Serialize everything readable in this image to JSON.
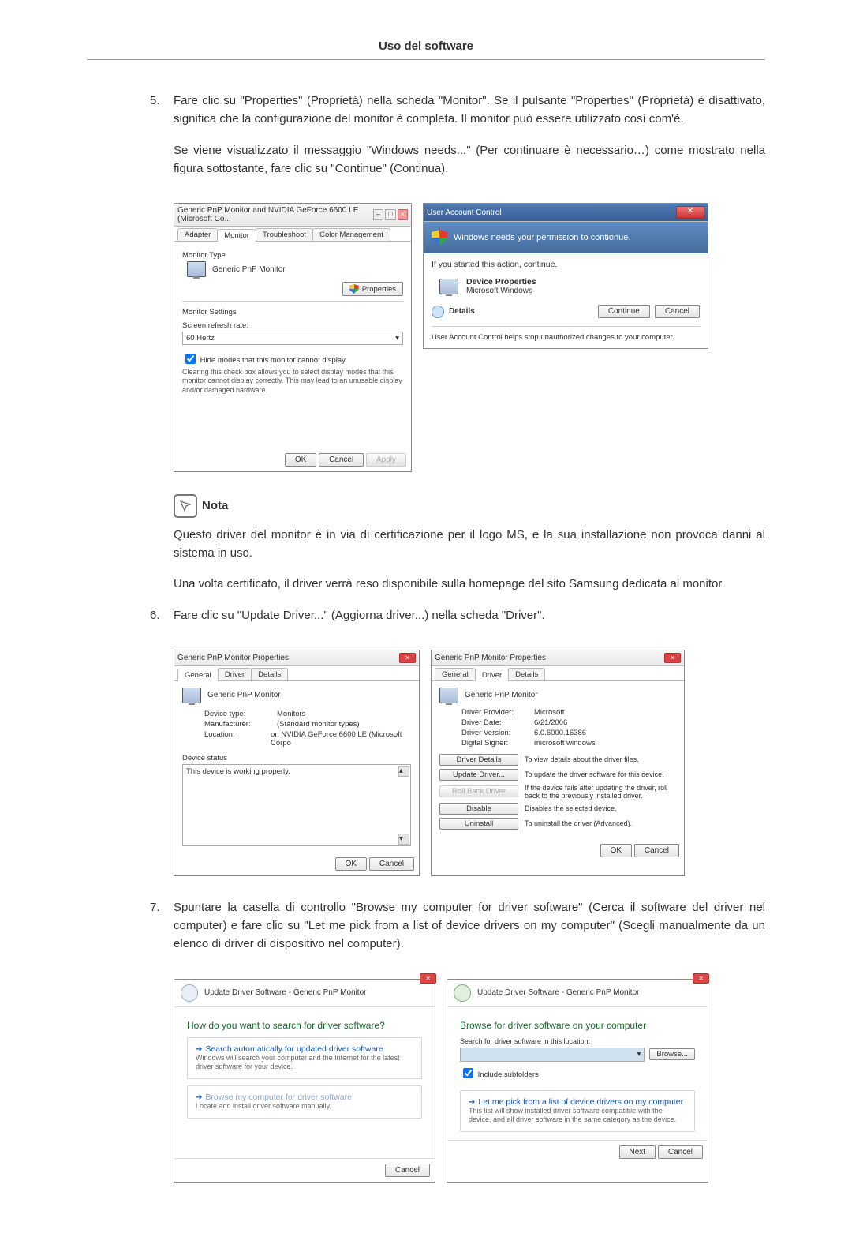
{
  "header": {
    "title": "Uso del software"
  },
  "steps": {
    "s5": {
      "num": "5.",
      "p1": "Fare clic su \"Properties\" (Proprietà) nella scheda \"Monitor\". Se il pulsante \"Properties\" (Proprietà) è disattivato, significa che la configurazione del monitor è completa. Il monitor può essere utilizzato così com'è.",
      "p2": "Se viene visualizzato il messaggio \"Windows needs...\" (Per continuare è necessario…) come mostrato nella figura sottostante, fare clic su \"Continue\" (Continua)."
    },
    "s6": {
      "num": "6.",
      "p1": "Fare clic su \"Update Driver...\" (Aggiorna driver...) nella scheda \"Driver\"."
    },
    "s7": {
      "num": "7.",
      "p1": "Spuntare la casella di controllo \"Browse my computer for driver software\" (Cerca il software del driver nel computer) e fare clic su \"Let me pick from a list of device drivers on my computer\" (Scegli manualmente da un elenco di driver di dispositivo nel computer)."
    }
  },
  "note": {
    "label": "Nota",
    "p1": "Questo driver del monitor è in via di certificazione per il logo MS, e la sua installazione non provoca danni al sistema in uso.",
    "p2": "Una volta certificato, il driver verrà reso disponibile sulla homepage del sito Samsung dedicata al monitor."
  },
  "dlg_monitor": {
    "title": "Generic PnP Monitor and NVIDIA GeForce 6600 LE (Microsoft Co...",
    "tabs": [
      "Adapter",
      "Monitor",
      "Troubleshoot",
      "Color Management"
    ],
    "monitor_type_label": "Monitor Type",
    "monitor_name": "Generic PnP Monitor",
    "properties_btn": "Properties",
    "settings_label": "Monitor Settings",
    "refresh_label": "Screen refresh rate:",
    "refresh_value": "60 Hertz",
    "hide_modes": "Hide modes that this monitor cannot display",
    "hide_modes_desc": "Clearing this check box allows you to select display modes that this monitor cannot display correctly. This may lead to an unusable display and/or damaged hardware.",
    "ok": "OK",
    "cancel": "Cancel",
    "apply": "Apply"
  },
  "dlg_uac": {
    "title": "User Account Control",
    "banner": "Windows needs your permission to contionue.",
    "started": "If you started this action, continue.",
    "item_title": "Device Properties",
    "item_pub": "Microsoft Windows",
    "details": "Details",
    "continue": "Continue",
    "cancel": "Cancel",
    "footer": "User Account Control helps stop unauthorized changes to your computer."
  },
  "dlg_general": {
    "title": "Generic PnP Monitor Properties",
    "tabs": [
      "General",
      "Driver",
      "Details"
    ],
    "name": "Generic PnP Monitor",
    "rows": [
      {
        "k": "Device type:",
        "v": "Monitors"
      },
      {
        "k": "Manufacturer:",
        "v": "(Standard monitor types)"
      },
      {
        "k": "Location:",
        "v": "on NVIDIA GeForce 6600 LE (Microsoft Corpo"
      }
    ],
    "status_label": "Device status",
    "status_text": "This device is working properly.",
    "ok": "OK",
    "cancel": "Cancel"
  },
  "dlg_driver": {
    "title": "Generic PnP Monitor Properties",
    "tabs": [
      "General",
      "Driver",
      "Details"
    ],
    "name": "Generic PnP Monitor",
    "rows": [
      {
        "k": "Driver Provider:",
        "v": "Microsoft"
      },
      {
        "k": "Driver Date:",
        "v": "6/21/2006"
      },
      {
        "k": "Driver Version:",
        "v": "6.0.6000.16386"
      },
      {
        "k": "Digital Signer:",
        "v": "microsoft windows"
      }
    ],
    "btns": [
      {
        "b": "Driver Details",
        "d": "To view details about the driver files."
      },
      {
        "b": "Update Driver...",
        "d": "To update the driver software for this device."
      },
      {
        "b": "Roll Back Driver",
        "d": "If the device fails after updating the driver, roll back to the previously installed driver."
      },
      {
        "b": "Disable",
        "d": "Disables the selected device."
      },
      {
        "b": "Uninstall",
        "d": "To uninstall the driver (Advanced)."
      }
    ],
    "ok": "OK",
    "cancel": "Cancel"
  },
  "wiz_search": {
    "crumb": "Update Driver Software - Generic PnP Monitor",
    "heading": "How do you want to search for driver software?",
    "opt1_t": "Search automatically for updated driver software",
    "opt1_d": "Windows will search your computer and the Internet for the latest driver software for your device.",
    "opt2_t": "Browse my computer for driver software",
    "opt2_d": "Locate and install driver software manually.",
    "cancel": "Cancel"
  },
  "wiz_browse": {
    "crumb": "Update Driver Software - Generic PnP Monitor",
    "heading": "Browse for driver software on your computer",
    "loc_label": "Search for driver software in this location:",
    "browse": "Browse...",
    "include": "Include subfolders",
    "opt_t": "Let me pick from a list of device drivers on my computer",
    "opt_d": "This list will show installed driver software compatible with the device, and all driver software in the same category as the device.",
    "next": "Next",
    "cancel": "Cancel"
  }
}
